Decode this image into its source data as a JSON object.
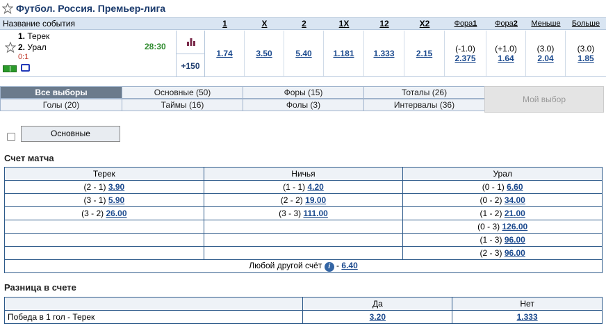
{
  "title": "Футбол. Россия. Премьер-лига",
  "event_header": {
    "name_col": "Название события",
    "cols": [
      {
        "label": "1"
      },
      {
        "label": "X"
      },
      {
        "label": "2"
      },
      {
        "label": "1X"
      },
      {
        "label": "12"
      },
      {
        "label": "X2"
      }
    ],
    "small_cols": [
      {
        "label_main": "Фора",
        "label_num": "1"
      },
      {
        "label_main": "Фора",
        "label_num": "2"
      },
      {
        "label_main": "Меньше",
        "label_num": ""
      },
      {
        "label_main": "Больше",
        "label_num": ""
      }
    ]
  },
  "event": {
    "team1_num": "1.",
    "team1": "Терек",
    "team2_num": "2.",
    "team2": "Урал",
    "score": "0:1",
    "timer": "28:30",
    "plus": "+150",
    "odds": [
      "1.74",
      "3.50",
      "5.40",
      "1.181",
      "1.333",
      "2.15"
    ],
    "fora1_param": "(-1.0)",
    "fora1_value": "2.375",
    "fora2_param": "(+1.0)",
    "fora2_value": "1.64",
    "less_param": "(3.0)",
    "less_value": "2.04",
    "more_param": "(3.0)",
    "more_value": "1.85"
  },
  "tabs": {
    "all": "Все выборы",
    "main": "Основные (50)",
    "foras": "Форы (15)",
    "totals": "Тоталы (26)",
    "goals": "Голы (20)",
    "times": "Таймы (16)",
    "fouls": "Фолы (3)",
    "intervals": "Интервалы (36)",
    "mine": "Мой выбор"
  },
  "filter": {
    "button": "Основные"
  },
  "match_score": {
    "title": "Счет матча",
    "headers": [
      "Терек",
      "Ничья",
      "Урал"
    ],
    "rows": [
      [
        {
          "s": "(2 - 1)",
          "o": "3.90"
        },
        {
          "s": "(1 - 1)",
          "o": "4.20"
        },
        {
          "s": "(0 - 1)",
          "o": "6.60"
        }
      ],
      [
        {
          "s": "(3 - 1)",
          "o": "5.90"
        },
        {
          "s": "(2 - 2)",
          "o": "19.00"
        },
        {
          "s": "(0 - 2)",
          "o": "34.00"
        }
      ],
      [
        {
          "s": "(3 - 2)",
          "o": "26.00"
        },
        {
          "s": "(3 - 3)",
          "o": "111.00"
        },
        {
          "s": "(1 - 2)",
          "o": "21.00"
        }
      ],
      [
        {
          "s": "",
          "o": ""
        },
        {
          "s": "",
          "o": ""
        },
        {
          "s": "(0 - 3)",
          "o": "126.00"
        }
      ],
      [
        {
          "s": "",
          "o": ""
        },
        {
          "s": "",
          "o": ""
        },
        {
          "s": "(1 - 3)",
          "o": "96.00"
        }
      ],
      [
        {
          "s": "",
          "o": ""
        },
        {
          "s": "",
          "o": ""
        },
        {
          "s": "(2 - 3)",
          "o": "96.00"
        }
      ]
    ],
    "other_label": "Любой другой счёт",
    "other_sep": "-",
    "other_odds": "6.40"
  },
  "diff": {
    "title": "Разница в счете",
    "headers": [
      "",
      "Да",
      "Нет"
    ],
    "rows": [
      {
        "label": "Победа в 1 гол - Терек",
        "yes": "3.20",
        "no": "1.333"
      }
    ]
  },
  "colors": {
    "header_bg": "#d9e5f2",
    "link": "#1c4a8e",
    "timer": "#2e8b2e",
    "score": "#c0392b"
  },
  "icons": [
    "star-icon",
    "stats-icon",
    "field-icon",
    "tv-icon",
    "info-icon"
  ]
}
